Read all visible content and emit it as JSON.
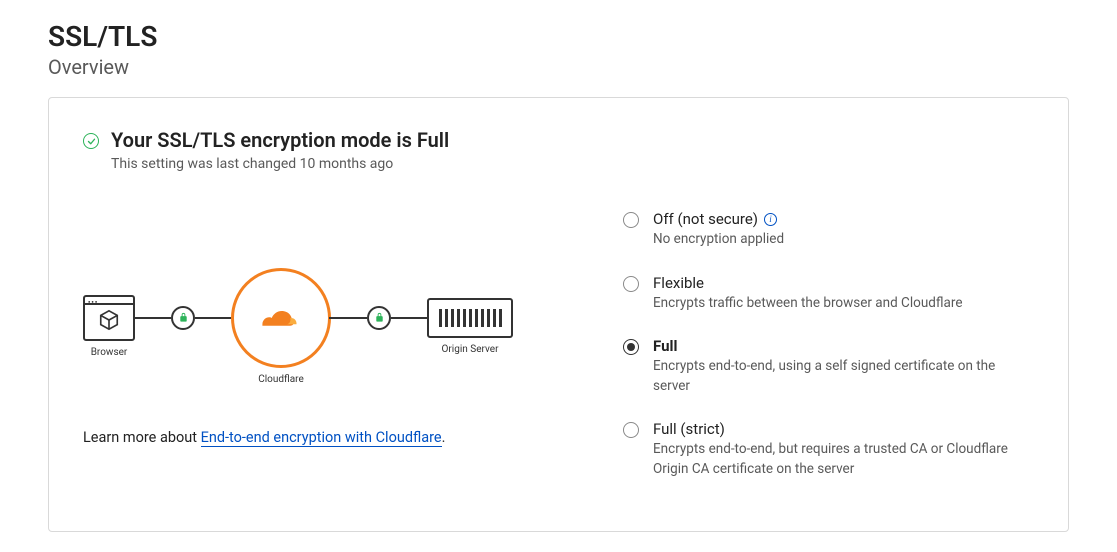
{
  "page": {
    "title": "SSL/TLS",
    "subtitle": "Overview"
  },
  "status": {
    "heading": "Your SSL/TLS encryption mode is Full",
    "subtext": "This setting was last changed 10 months ago"
  },
  "diagram": {
    "browser_label": "Browser",
    "cloudflare_label": "Cloudflare",
    "origin_label": "Origin Server"
  },
  "options": [
    {
      "label": "Off (not secure)",
      "desc": "No encryption applied",
      "selected": false,
      "info": true
    },
    {
      "label": "Flexible",
      "desc": "Encrypts traffic between the browser and Cloudflare",
      "selected": false,
      "info": false
    },
    {
      "label": "Full",
      "desc": "Encrypts end-to-end, using a self signed certificate on the server",
      "selected": true,
      "info": false
    },
    {
      "label": "Full (strict)",
      "desc": "Encrypts end-to-end, but requires a trusted CA or Cloudflare Origin CA certificate on the server",
      "selected": false,
      "info": false
    }
  ],
  "learn_more": {
    "prefix": "Learn more about ",
    "link_text": "End-to-end encryption with Cloudflare",
    "suffix": "."
  }
}
